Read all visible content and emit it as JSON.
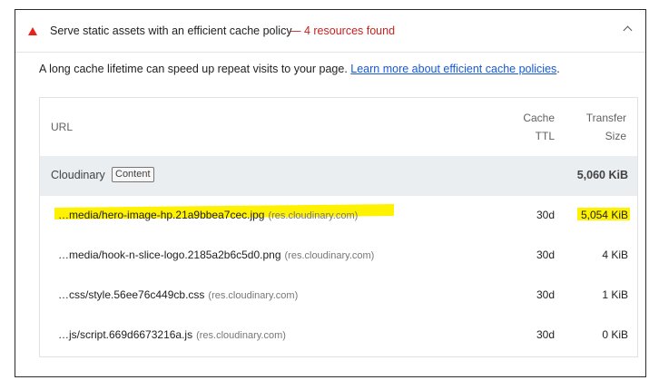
{
  "audit": {
    "title": "Serve static assets with an efficient cache policy",
    "summary": "— 4 resources found",
    "description": "A long cache lifetime can speed up repeat visits to your page.",
    "learn_more_link": "Learn more about efficient cache policies",
    "trailing_punct": "."
  },
  "table": {
    "headers": {
      "url": "URL",
      "cache_ttl_line1": "Cache",
      "cache_ttl_line2": "TTL",
      "transfer_line1": "Transfer",
      "transfer_line2": "Size"
    },
    "group": {
      "name": "Cloudinary",
      "chip": "Content",
      "total": "5,060 KiB"
    },
    "rows": [
      {
        "url": "…media/hero-image-hp.21a9bbea7cec.jpg",
        "host": "(res.cloudinary.com)",
        "ttl": "30d",
        "size": "5,054 KiB"
      },
      {
        "url": "…media/hook-n-slice-logo.2185a2b6c5d0.png",
        "host": "(res.cloudinary.com)",
        "ttl": "30d",
        "size": "4 KiB"
      },
      {
        "url": "…css/style.56ee76c449cb.css",
        "host": "(res.cloudinary.com)",
        "ttl": "30d",
        "size": "1 KiB"
      },
      {
        "url": "…js/script.669d6673216a.js",
        "host": "(res.cloudinary.com)",
        "ttl": "30d",
        "size": "0 KiB"
      }
    ]
  },
  "colors": {
    "warning": "#e8211b",
    "highlight": "#fff200",
    "link": "#1558d6"
  },
  "icons": {
    "warning": "warning-triangle-icon",
    "collapse": "chevron-up-icon"
  }
}
